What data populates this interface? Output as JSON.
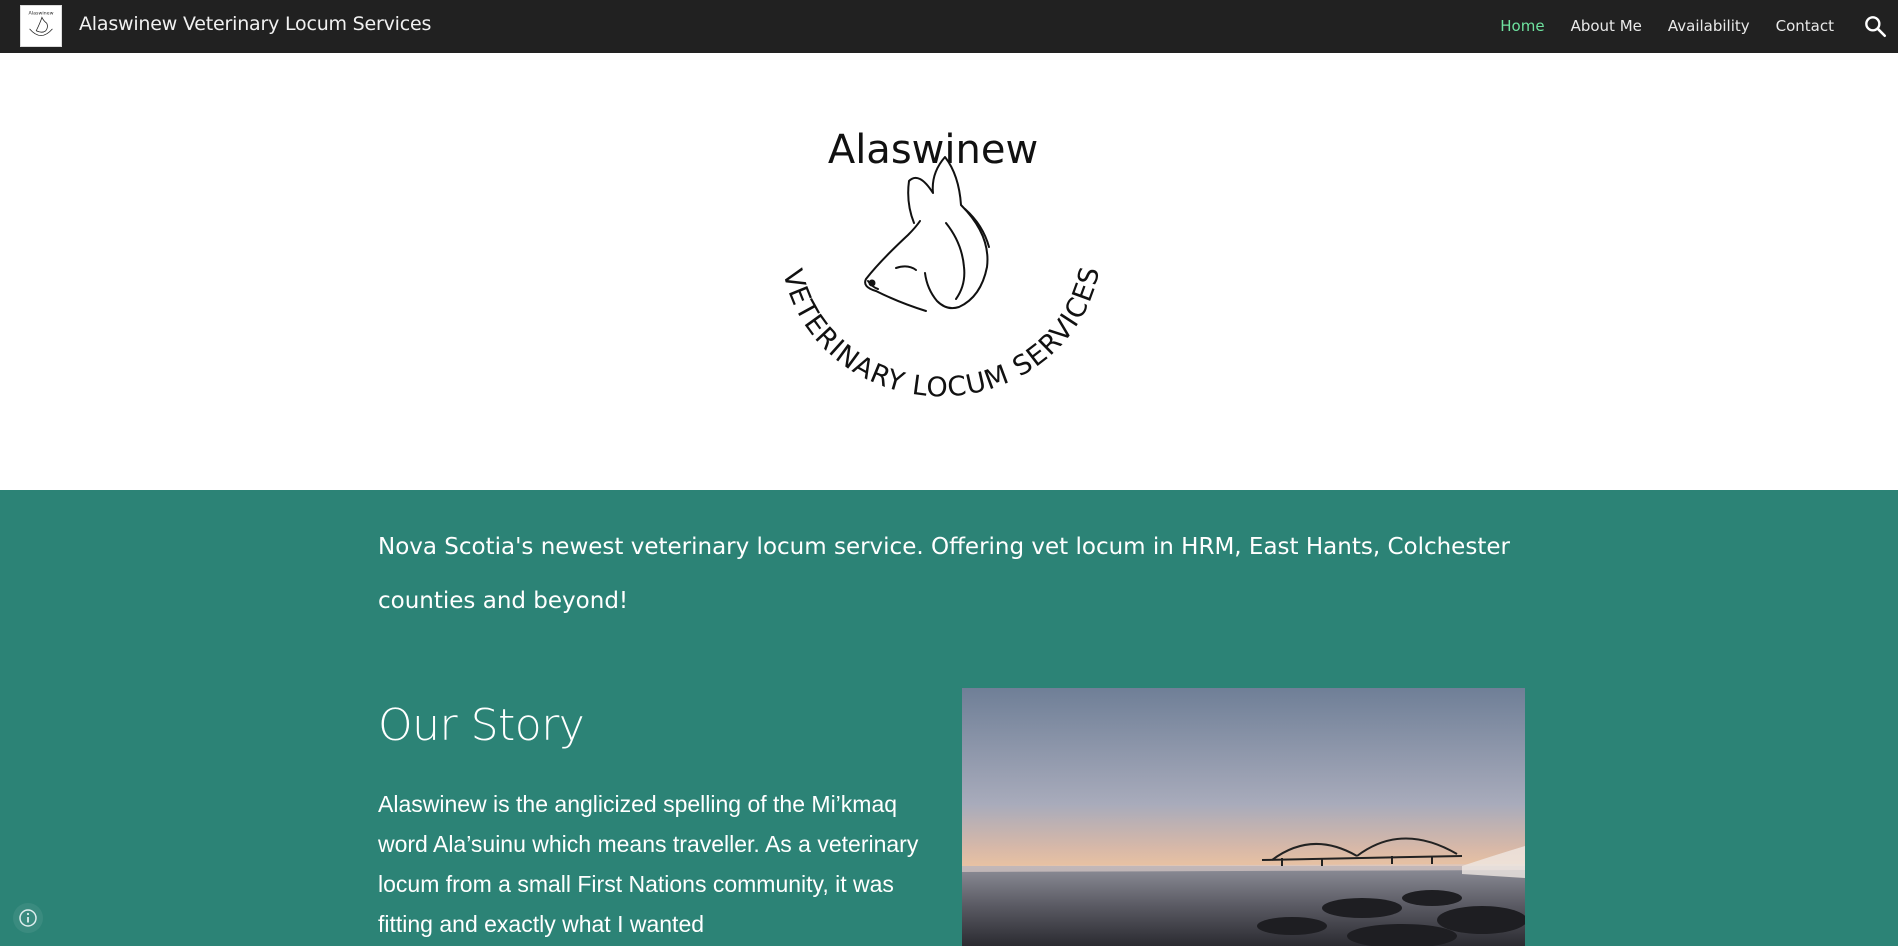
{
  "header": {
    "site_title": "Alaswinew Veterinary Locum Services",
    "logo_text": "Alaswinew",
    "nav": [
      {
        "label": "Home",
        "active": true
      },
      {
        "label": "About Me",
        "active": false
      },
      {
        "label": "Availability",
        "active": false
      },
      {
        "label": "Contact",
        "active": false
      }
    ],
    "search_icon": "search-icon"
  },
  "hero": {
    "logo_title": "Alaswinew",
    "logo_arc_text": "VETERINARY LOCUM SERVICES"
  },
  "intro": {
    "text": "Nova Scotia's newest veterinary locum service.  Offering vet locum in HRM, East Hants, Colchester counties and beyond!"
  },
  "story": {
    "heading": "Our Story",
    "body": "Alaswinew is the anglicized spelling of the Mi’kmaq word Ala’suinu which means traveller. As a veterinary locum from a small First Nations community, it was fitting and exactly what I wanted"
  },
  "colors": {
    "topbar": "#212121",
    "accent_active": "#6ee29f",
    "teal_section": "#2c8376"
  }
}
